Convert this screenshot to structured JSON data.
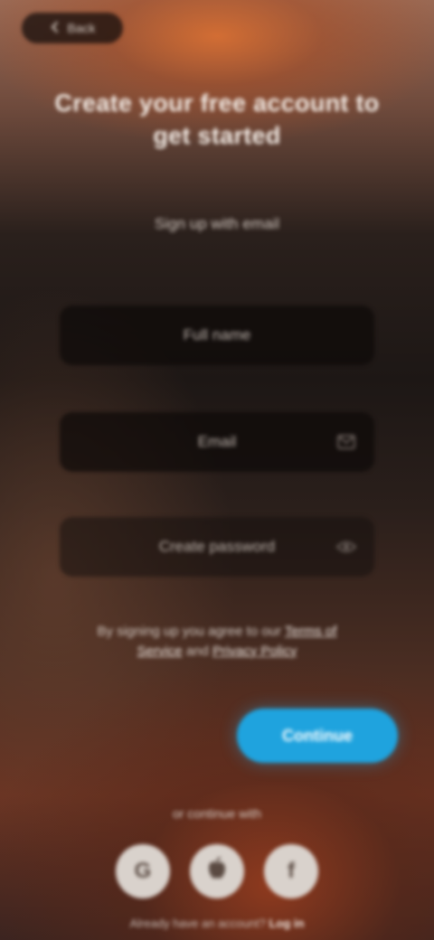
{
  "top_pill": {
    "icon": "arrow-left-icon",
    "label": "Back"
  },
  "header": {
    "title": "Create your free account to get started",
    "subtitle": "Sign up with email"
  },
  "form": {
    "name_placeholder": "Full name",
    "email_placeholder": "Email",
    "email_icon": "mail-icon",
    "password_placeholder": "Create password",
    "password_icon": "eye-icon",
    "terms_prefix": "By signing up you agree to our",
    "terms_link": "Terms of Service",
    "terms_middle": "and",
    "privacy_link": "Privacy Policy",
    "submit_label": "Continue"
  },
  "social": {
    "label": "or continue with",
    "providers": [
      {
        "name": "Google",
        "glyph": "G",
        "icon": "google-icon"
      },
      {
        "name": "Apple",
        "glyph": "",
        "icon": "apple-icon"
      },
      {
        "name": "Facebook",
        "glyph": "f",
        "icon": "facebook-icon"
      }
    ]
  },
  "footer": {
    "prefix": "Already have an account?",
    "link": "Log in"
  },
  "colors": {
    "accent": "#1fa3de",
    "field_bg": "#0e0a09",
    "social_bg": "#d9d2cc"
  }
}
